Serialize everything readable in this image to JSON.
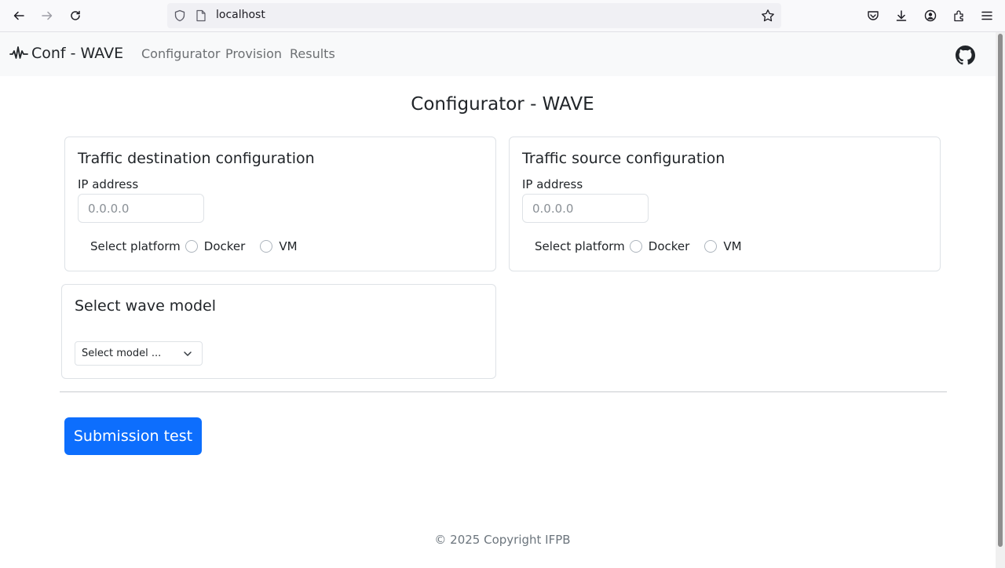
{
  "browser": {
    "url": "localhost"
  },
  "nav": {
    "brand": "Conf - WAVE",
    "links": [
      "Configurator",
      "Provision",
      "Results"
    ]
  },
  "page": {
    "title": "Configurator - WAVE"
  },
  "destination": {
    "title": "Traffic destination configuration",
    "ip_label": "IP address",
    "ip_placeholder": "0.0.0.0",
    "platform_label": "Select platform",
    "options": [
      "Docker",
      "VM"
    ]
  },
  "source": {
    "title": "Traffic source configuration",
    "ip_label": "IP address",
    "ip_placeholder": "0.0.0.0",
    "platform_label": "Select platform",
    "options": [
      "Docker",
      "VM"
    ]
  },
  "model": {
    "title": "Select wave model",
    "select_value": "Select model ..."
  },
  "submit_label": "Submission test",
  "footer": "© 2025 Copyright IFPB",
  "colors": {
    "primary": "#0d6efd",
    "navbar_bg": "#f8f9fa",
    "border": "#dee2e6"
  }
}
